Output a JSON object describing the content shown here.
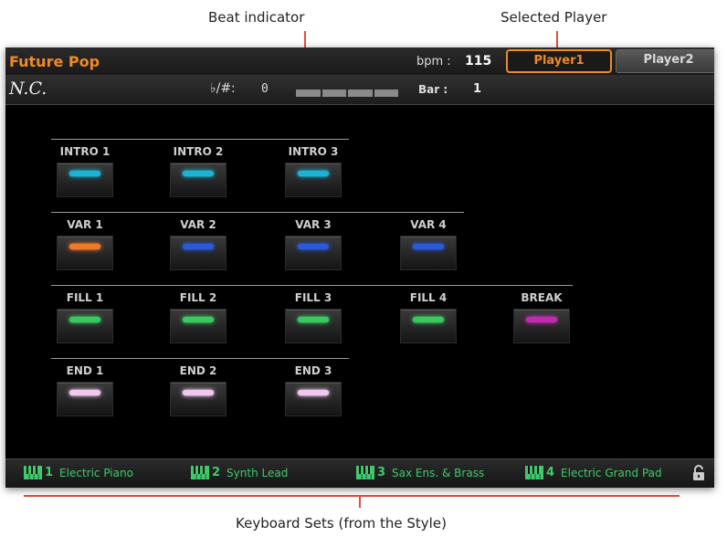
{
  "callouts": {
    "beat_indicator": "Beat indicator",
    "selected_player": "Selected Player",
    "keyboard_sets": "Keyboard Sets (from the Style)"
  },
  "header": {
    "style_name": "Future Pop",
    "bpm_label": "bpm :",
    "bpm_value": "115",
    "players": [
      "Player1",
      "Player2"
    ],
    "selected_player": "Player1"
  },
  "status": {
    "chord": "N.C.",
    "transpose_label": "♭/#:",
    "transpose_value": "0",
    "bar_label": "Bar :",
    "bar_value": "1"
  },
  "sections": {
    "intro": {
      "labels": [
        "INTRO 1",
        "INTRO 2",
        "INTRO 3"
      ],
      "led": [
        "cyan",
        "cyan",
        "cyan"
      ]
    },
    "var": {
      "labels": [
        "VAR 1",
        "VAR 2",
        "VAR 3",
        "VAR 4"
      ],
      "led": [
        "orange",
        "blue",
        "blue",
        "blue"
      ]
    },
    "fill": {
      "labels": [
        "FILL 1",
        "FILL 2",
        "FILL 3",
        "FILL 4",
        "BREAK"
      ],
      "led": [
        "green",
        "green",
        "green",
        "green",
        "magenta"
      ]
    },
    "end": {
      "labels": [
        "END 1",
        "END 2",
        "END 3"
      ],
      "led": [
        "pink",
        "pink",
        "pink"
      ]
    }
  },
  "led_colors": {
    "cyan": "#19b4d8",
    "orange": "#f07a2c",
    "blue": "#2a5ad8",
    "green": "#3ac860",
    "magenta": "#c02ab0",
    "pink": "#f0c8ee"
  },
  "keyboard_sets": [
    {
      "num": "1",
      "name": "Electric Piano"
    },
    {
      "num": "2",
      "name": "Synth Lead"
    },
    {
      "num": "3",
      "name": "Sax Ens. & Brass"
    },
    {
      "num": "4",
      "name": "Electric Grand Pad"
    }
  ],
  "icons": {
    "keyboard": "keyboard-icon",
    "lock": "lock-icon"
  },
  "colors": {
    "accent": "#f08a24",
    "keyboard_text": "#3fc96a",
    "callout_line": "#e0503c"
  }
}
